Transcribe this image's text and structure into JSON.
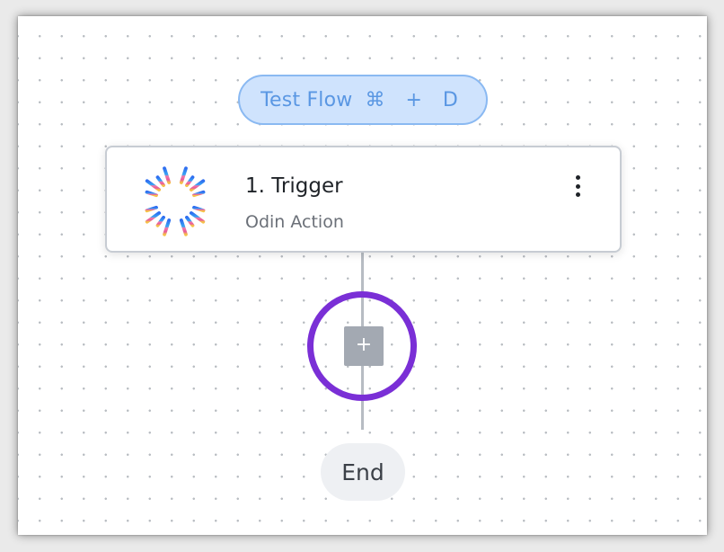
{
  "toolbar": {
    "test_flow_label": "Test Flow",
    "test_flow_shortcut": "⌘ + D"
  },
  "trigger_card": {
    "title": "1. Trigger",
    "subtitle": "Odin Action",
    "menu_icon": "kebab-menu-icon",
    "logo_icon": "odin-sunburst-logo"
  },
  "add_step": {
    "label": "+"
  },
  "end_node": {
    "label": "End"
  },
  "colors": {
    "accent_blue": "#5a97e3",
    "highlight_purple": "#7a2fd6",
    "connector_gray": "#b7bcc3"
  }
}
